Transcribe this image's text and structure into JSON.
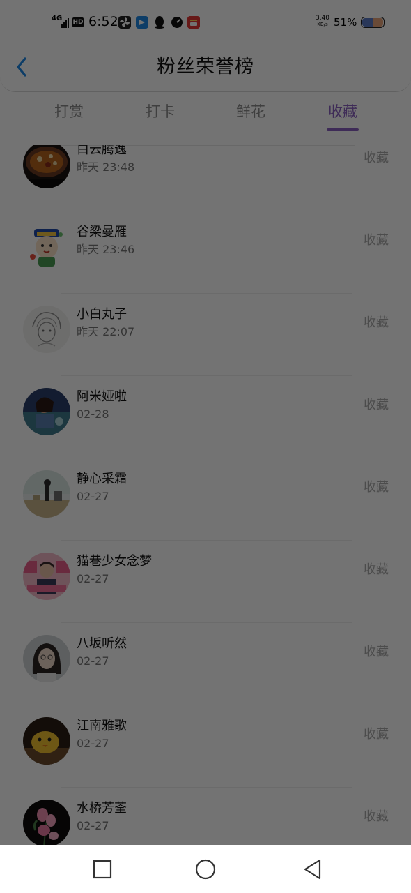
{
  "status_bar": {
    "network": "4G",
    "hd_badge": "HD",
    "time": "6:52",
    "speed_value": "3.40",
    "speed_unit": "KB/s",
    "battery_percent": "51%",
    "battery_level": 0.51,
    "app_icons": [
      "fan-icon",
      "shield-app-icon",
      "qq-penguin-icon",
      "speed-dial-icon",
      "news-app-icon"
    ]
  },
  "header": {
    "title": "粉丝荣誉榜",
    "back_icon": "chevron-left-icon",
    "accent_color": "#1e88e5"
  },
  "tabs": [
    {
      "label": "打赏",
      "active": false
    },
    {
      "label": "打卡",
      "active": false
    },
    {
      "label": "鲜花",
      "active": false
    },
    {
      "label": "收藏",
      "active": true
    }
  ],
  "colors": {
    "active_tab": "#8a5fc0",
    "overlay": "rgba(0,0,0,0.55)"
  },
  "list": {
    "items": [
      {
        "name": "白云腾逸",
        "date": "昨天 23:48",
        "action": "收藏",
        "avatar": "food-avatar"
      },
      {
        "name": "谷梁曼雁",
        "date": "昨天 23:46",
        "action": "收藏",
        "avatar": "cartoon-avatar"
      },
      {
        "name": "小白丸子",
        "date": "昨天 22:07",
        "action": "收藏",
        "avatar": "sketch-avatar"
      },
      {
        "name": "阿米娅啦",
        "date": "02-28",
        "action": "收藏",
        "avatar": "photo-avatar"
      },
      {
        "name": "静心采霜",
        "date": "02-27",
        "action": "收藏",
        "avatar": "beach-avatar"
      },
      {
        "name": "猫巷少女念梦",
        "date": "02-27",
        "action": "收藏",
        "avatar": "pink-poster-avatar"
      },
      {
        "name": "八坂听然",
        "date": "02-27",
        "action": "收藏",
        "avatar": "girl-portrait-avatar"
      },
      {
        "name": "江南雅歌",
        "date": "02-27",
        "action": "收藏",
        "avatar": "yellow-chick-avatar"
      },
      {
        "name": "水桥芳荃",
        "date": "02-27",
        "action": "收藏",
        "avatar": "pink-flower-avatar"
      }
    ]
  },
  "nav_bar": {
    "recent_icon": "square-icon",
    "home_icon": "circle-icon",
    "back_icon": "triangle-back-icon"
  }
}
